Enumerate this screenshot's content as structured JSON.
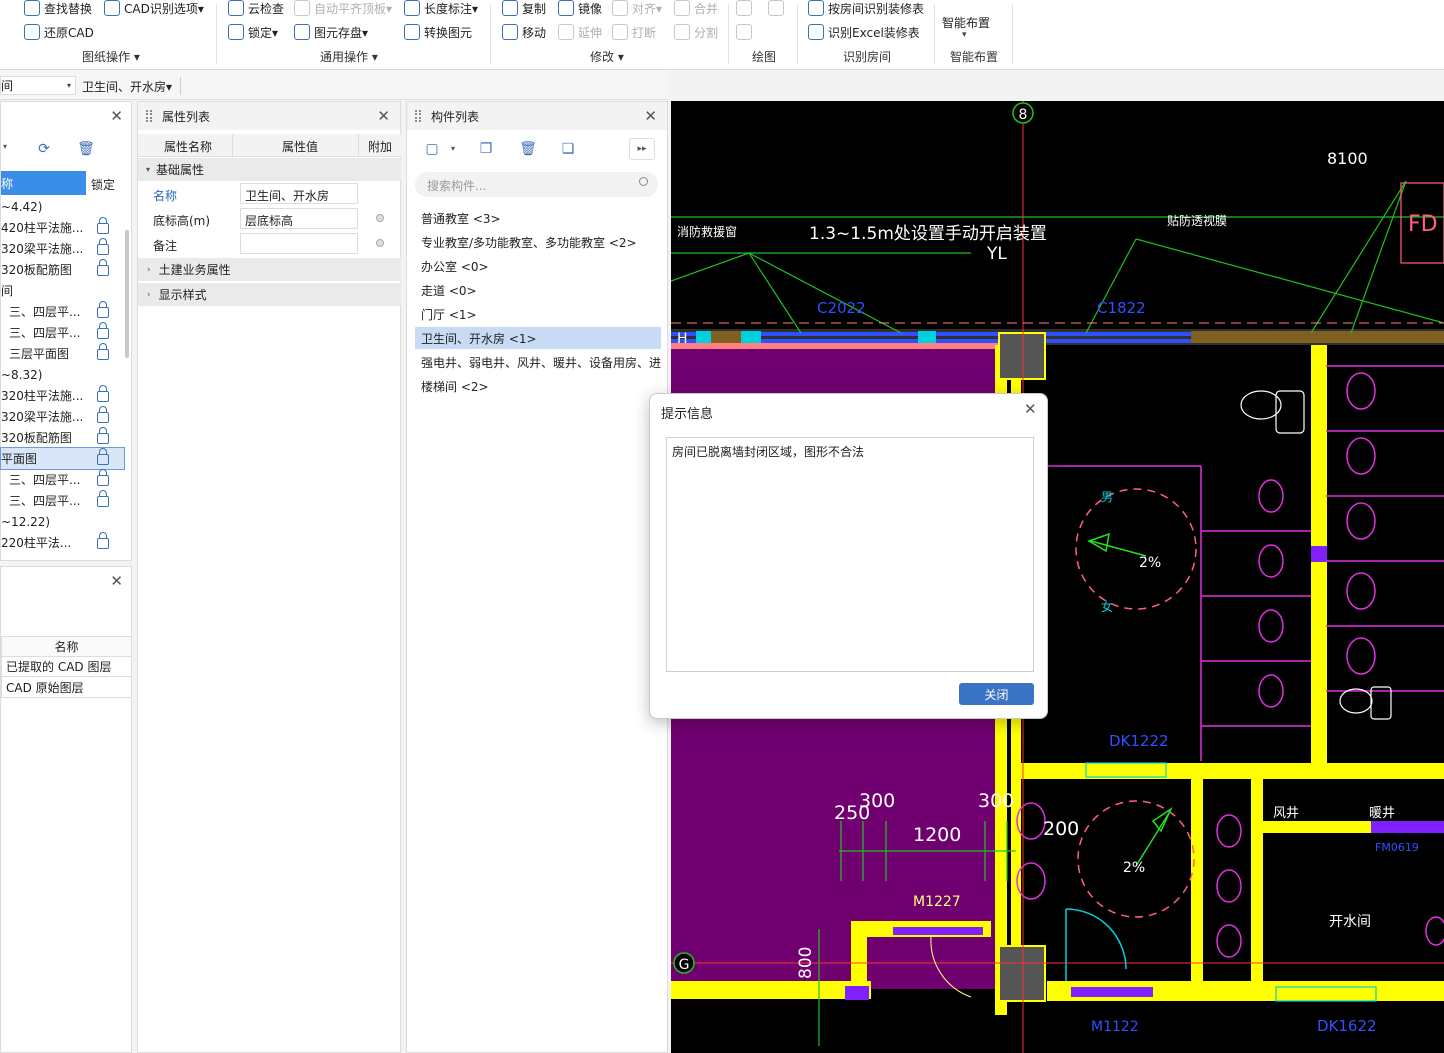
{
  "ribbon": {
    "groups": [
      {
        "label": "图纸操作 ▾",
        "items": [
          "查找替换",
          "CAD识别选项▾",
          "还原CAD"
        ]
      },
      {
        "label": "通用操作 ▾",
        "items": [
          "云检查",
          "自动平齐顶板▾",
          "长度标注▾",
          "锁定▾",
          "图元存盘▾",
          "转换图元"
        ]
      },
      {
        "label": "修改 ▾",
        "items": [
          "复制",
          "镜像",
          "对齐▾",
          "合并",
          "移动",
          "延伸",
          "打断",
          "分割"
        ]
      },
      {
        "label": "绘图"
      },
      {
        "label": "识别房间",
        "items": [
          "按房间识别装修表",
          "识别Excel装修表"
        ]
      },
      {
        "label": "智能布置",
        "items": [
          "智能布置"
        ]
      }
    ]
  },
  "toolbar2": {
    "dropdown1": "间",
    "dropdown2": "卫生间、开水房▾"
  },
  "layers_panel": {
    "headers": [
      "称",
      "锁定"
    ],
    "rows": [
      "~4.42)",
      "420柱平法施...",
      "320梁平法施...",
      "320板配筋图",
      "间",
      "三、四层平...",
      "三、四层平...",
      "三层平面图",
      "~8.32)",
      "320柱平法施...",
      "320梁平法施...",
      "320板配筋图",
      "平面图",
      "三、四层平...",
      "三、四层平...",
      "~12.22)",
      "220柱平法..."
    ]
  },
  "cad_layers": {
    "header": "名称",
    "rows": [
      "已提取的 CAD 图层",
      "CAD 原始图层"
    ]
  },
  "props": {
    "title": "属性列表",
    "headers": [
      "属性名称",
      "属性值",
      "附加"
    ],
    "group1": "基础属性",
    "rows": [
      [
        "名称",
        "卫生间、开水房"
      ],
      [
        "底标高(m)",
        "层底标高"
      ],
      [
        "备注",
        ""
      ]
    ],
    "group2": "土建业务属性",
    "group3": "显示样式"
  },
  "components": {
    "title": "构件列表",
    "search_placeholder": "搜索构件...",
    "items": [
      "普通教室 <3>",
      "专业教室/多功能教室、多功能教室 <2>",
      "办公室 <0>",
      "走道 <0>",
      "门厅 <1>",
      "卫生间、开水房 <1>",
      "强电井、弱电井、风井、暖井、设备用房、进",
      "楼梯间 <2>"
    ]
  },
  "dialog": {
    "title": "提示信息",
    "message": "房间已脱离墙封闭区域，图形不合法",
    "close_label": "关闭"
  },
  "cad_text": {
    "axis8": "8",
    "axisG": "G",
    "dim8100": "8100",
    "note1": "消防救援窗",
    "note2": "1.3~1.5m处设置手动开启装置",
    "note3": "贴防透视膜",
    "yl": "YL",
    "c2022": "C2022",
    "c1822": "C1822",
    "fd": "FD",
    "h": "H",
    "dk1222": "DK1222",
    "dk1622": "DK1622",
    "m1227": "M1227",
    "m1122": "M1122",
    "d250": "250",
    "d300a": "300",
    "d300b": "300",
    "d1200": "1200",
    "d200": "200",
    "d800": "800",
    "slope1": "2%",
    "slope2": "2%",
    "nan": "男",
    "nv": "女",
    "fengjing": "风井",
    "nuanjing": "暖井",
    "kaishuijian": "开水间",
    "fm": "FM0619"
  },
  "colors": {
    "accent": "#3b73c5",
    "cad_bg": "#000000",
    "wall": "#ffff00",
    "room": "#700070",
    "magenta": "#e030e0",
    "green": "#20c020",
    "cyan": "#00d0e0",
    "blue": "#3050ff",
    "selected": "#c7dcf4"
  }
}
